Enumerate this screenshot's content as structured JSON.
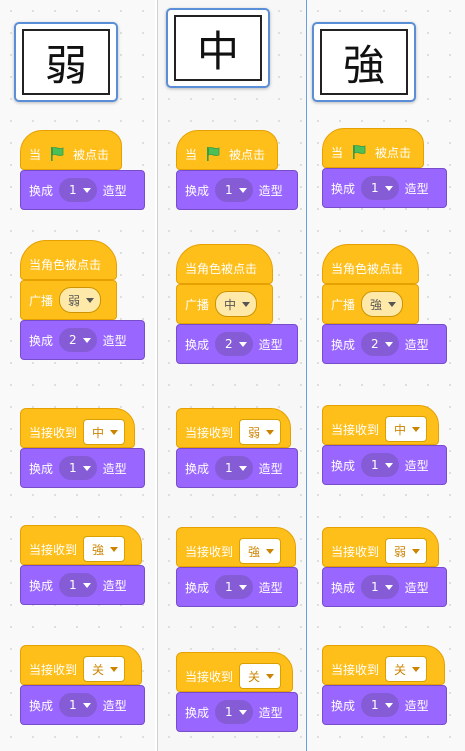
{
  "columns": [
    {
      "title": "弱",
      "stacks": [
        {
          "type": "flag",
          "prefix": "当",
          "suffix": "被点击",
          "costume_label": "换成",
          "costume_value": "1",
          "costume_suffix": "造型"
        },
        {
          "type": "sprite",
          "hat": "当角色被点击",
          "broadcast_label": "广播",
          "broadcast_value": "弱",
          "costume_label": "换成",
          "costume_value": "2",
          "costume_suffix": "造型"
        },
        {
          "type": "receive",
          "hat_label": "当接收到",
          "message": "中",
          "costume_label": "换成",
          "costume_value": "1",
          "costume_suffix": "造型"
        },
        {
          "type": "receive",
          "hat_label": "当接收到",
          "message": "強",
          "costume_label": "换成",
          "costume_value": "1",
          "costume_suffix": "造型"
        },
        {
          "type": "receive",
          "hat_label": "当接收到",
          "message": "关",
          "costume_label": "换成",
          "costume_value": "1",
          "costume_suffix": "造型"
        }
      ]
    },
    {
      "title": "中",
      "stacks": [
        {
          "type": "flag",
          "prefix": "当",
          "suffix": "被点击",
          "costume_label": "换成",
          "costume_value": "1",
          "costume_suffix": "造型"
        },
        {
          "type": "sprite",
          "hat": "当角色被点击",
          "broadcast_label": "广播",
          "broadcast_value": "中",
          "costume_label": "换成",
          "costume_value": "2",
          "costume_suffix": "造型"
        },
        {
          "type": "receive",
          "hat_label": "当接收到",
          "message": "弱",
          "costume_label": "换成",
          "costume_value": "1",
          "costume_suffix": "造型"
        },
        {
          "type": "receive",
          "hat_label": "当接收到",
          "message": "強",
          "costume_label": "换成",
          "costume_value": "1",
          "costume_suffix": "造型"
        },
        {
          "type": "receive",
          "hat_label": "当接收到",
          "message": "关",
          "costume_label": "换成",
          "costume_value": "1",
          "costume_suffix": "造型"
        }
      ]
    },
    {
      "title": "強",
      "stacks": [
        {
          "type": "flag",
          "prefix": "当",
          "suffix": "被点击",
          "costume_label": "换成",
          "costume_value": "1",
          "costume_suffix": "造型"
        },
        {
          "type": "sprite",
          "hat": "当角色被点击",
          "broadcast_label": "广播",
          "broadcast_value": "強",
          "costume_label": "换成",
          "costume_value": "2",
          "costume_suffix": "造型"
        },
        {
          "type": "receive",
          "hat_label": "当接收到",
          "message": "中",
          "costume_label": "换成",
          "costume_value": "1",
          "costume_suffix": "造型"
        },
        {
          "type": "receive",
          "hat_label": "当接收到",
          "message": "弱",
          "costume_label": "换成",
          "costume_value": "1",
          "costume_suffix": "造型"
        },
        {
          "type": "receive",
          "hat_label": "当接收到",
          "message": "关",
          "costume_label": "换成",
          "costume_value": "1",
          "costume_suffix": "造型"
        }
      ]
    }
  ],
  "colors": {
    "events": "#ffbf1a",
    "looks": "#9966ff",
    "flag": "#4cbf56"
  },
  "icons": {
    "flag": "green-flag-icon",
    "dropdown": "chevron-down-icon"
  }
}
